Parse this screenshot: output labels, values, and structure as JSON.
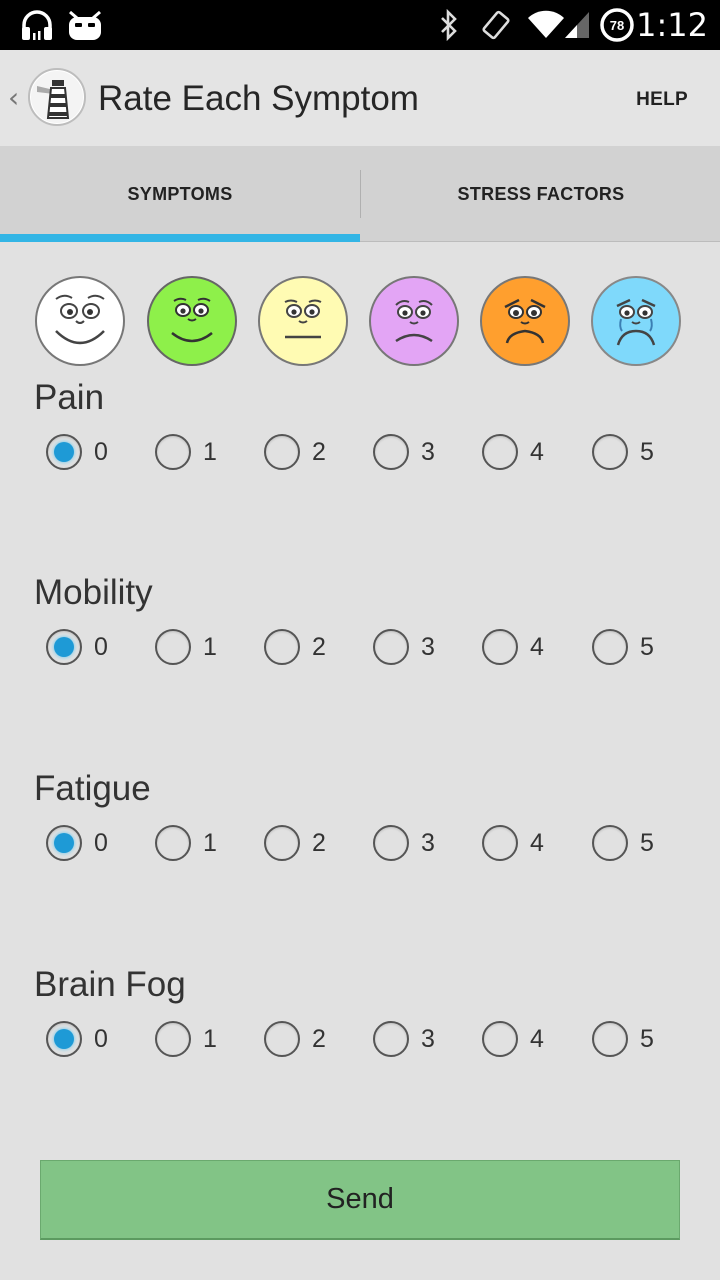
{
  "status_bar": {
    "time": "1:12",
    "battery_level": "78",
    "left_icons": [
      "headphones-icon",
      "cyanogen-droid-icon"
    ],
    "right_icons": [
      "bluetooth-icon",
      "rotation-icon",
      "wifi-icon",
      "cell-signal-icon",
      "battery-icon"
    ]
  },
  "action_bar": {
    "title": "Rate Each Symptom",
    "help_label": "HELP",
    "logo_icon": "lighthouse-logo-icon",
    "back_icon": "chevron-left-icon"
  },
  "tabs": [
    {
      "label": "SYMPTOMS",
      "selected": true
    },
    {
      "label": "STRESS FACTORS",
      "selected": false
    }
  ],
  "colors": {
    "tab_indicator": "#33b5e5",
    "radio_checked": "#1e9ad6",
    "send_button": "#82c486",
    "face_0": "#ffffff",
    "face_1": "#8ef04a",
    "face_2": "#fffbb3",
    "face_3": "#e3a5f5",
    "face_4": "#ff9f2e",
    "face_5": "#7fd9fb"
  },
  "faces": [
    {
      "icon": "very-happy-face-icon",
      "color": "#ffffff"
    },
    {
      "icon": "happy-face-icon",
      "color": "#8ef04a"
    },
    {
      "icon": "neutral-face-icon",
      "color": "#fffbb3"
    },
    {
      "icon": "sad-face-icon",
      "color": "#e3a5f5"
    },
    {
      "icon": "worried-face-icon",
      "color": "#ff9f2e"
    },
    {
      "icon": "crying-face-icon",
      "color": "#7fd9fb"
    }
  ],
  "scale_options": [
    "0",
    "1",
    "2",
    "3",
    "4",
    "5"
  ],
  "symptoms": [
    {
      "label": "Pain",
      "selected": "0"
    },
    {
      "label": "Mobility",
      "selected": "0"
    },
    {
      "label": "Fatigue",
      "selected": "0"
    },
    {
      "label": "Brain Fog",
      "selected": "0"
    }
  ],
  "send_label": "Send"
}
